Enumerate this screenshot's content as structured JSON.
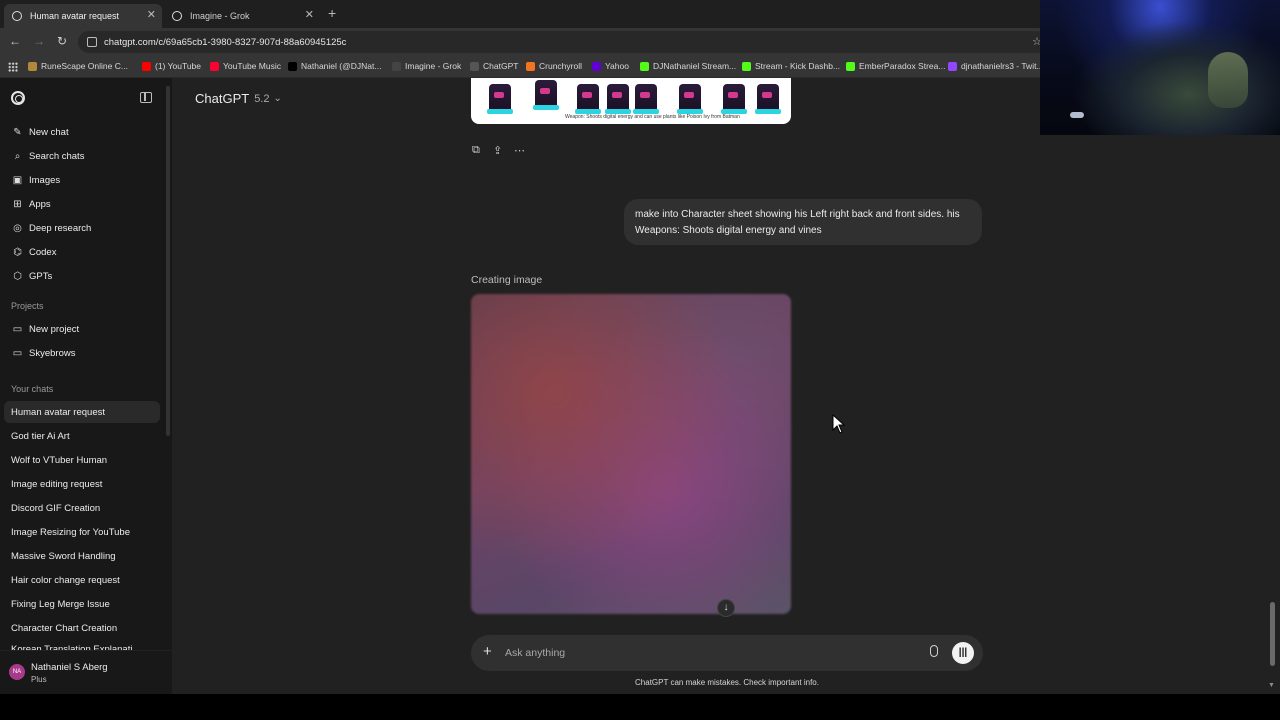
{
  "browser": {
    "tabs": [
      {
        "title": "Human avatar request",
        "active": true
      },
      {
        "title": "Imagine - Grok",
        "active": false
      }
    ],
    "url": "chatgpt.com/c/69a65cb1-3980-8327-907d-88a60945125c",
    "bookmarks": [
      {
        "label": "RuneScape Online C...",
        "icon": "runescape-icon",
        "color": "#b08a3a"
      },
      {
        "label": "(1) YouTube",
        "icon": "youtube-icon",
        "color": "#ff0000"
      },
      {
        "label": "YouTube Music",
        "icon": "youtube-music-icon",
        "color": "#ff0033"
      },
      {
        "label": "Nathaniel (@DJNat...",
        "icon": "x-icon",
        "color": "#000000"
      },
      {
        "label": "Imagine - Grok",
        "icon": "grok-icon",
        "color": "#444444"
      },
      {
        "label": "ChatGPT",
        "icon": "chatgpt-icon",
        "color": "#555555"
      },
      {
        "label": "Crunchyroll",
        "icon": "crunchyroll-icon",
        "color": "#f47521"
      },
      {
        "label": "Yahoo",
        "icon": "yahoo-icon",
        "color": "#6001d2"
      },
      {
        "label": "DJNathaniel Stream...",
        "icon": "kick-icon",
        "color": "#53fc18"
      },
      {
        "label": "Stream - Kick Dashb...",
        "icon": "kick-icon",
        "color": "#53fc18"
      },
      {
        "label": "EmberParadox Strea...",
        "icon": "kick-icon",
        "color": "#53fc18"
      },
      {
        "label": "djnathanielrs3 - Twit...",
        "icon": "twitch-icon",
        "color": "#9146ff"
      }
    ]
  },
  "sidebar": {
    "nav": [
      {
        "label": "New chat",
        "icon": "new-chat-icon",
        "glyph": "✎"
      },
      {
        "label": "Search chats",
        "icon": "search-icon",
        "glyph": "⌕"
      },
      {
        "label": "Images",
        "icon": "images-icon",
        "glyph": "▣"
      },
      {
        "label": "Apps",
        "icon": "apps-icon",
        "glyph": "⊞"
      },
      {
        "label": "Deep research",
        "icon": "deep-research-icon",
        "glyph": "◎"
      },
      {
        "label": "Codex",
        "icon": "codex-icon",
        "glyph": "⌬"
      },
      {
        "label": "GPTs",
        "icon": "gpts-icon",
        "glyph": "⬡"
      }
    ],
    "projects_label": "Projects",
    "projects": [
      {
        "label": "New project",
        "icon": "new-project-icon",
        "glyph": "▭"
      },
      {
        "label": "Skyebrows",
        "icon": "folder-icon",
        "glyph": "▭"
      }
    ],
    "chats_label": "Your chats",
    "chats": [
      "Human avatar request",
      "God tier Ai Art",
      "Wolf to VTuber Human",
      "Image editing request",
      "Discord GIF Creation",
      "Image Resizing for YouTube",
      "Massive Sword Handling",
      "Hair color change request",
      "Fixing Leg Merge Issue",
      "Character Chart Creation",
      "Korean Translation Explanati..."
    ],
    "user": {
      "initials": "NA",
      "name": "Nathaniel S Aberg",
      "plan": "Plus"
    }
  },
  "main": {
    "model_name": "ChatGPT",
    "model_version": "5.2",
    "previous_image_caption": "Weapon: Shoots digital energy and can use plants like Poison Ivy from Batman",
    "user_message": "make into Character sheet showing his Left right back and front sides. his Weapons: Shoots digital energy and vines",
    "status": "Creating image",
    "composer_placeholder": "Ask anything",
    "disclaimer": "ChatGPT can make mistakes. Check important info."
  },
  "colors": {
    "sidebar_bg": "#181818",
    "main_bg": "#212121",
    "bubble_bg": "#303030",
    "avatar_bg": "#a83a8c"
  }
}
